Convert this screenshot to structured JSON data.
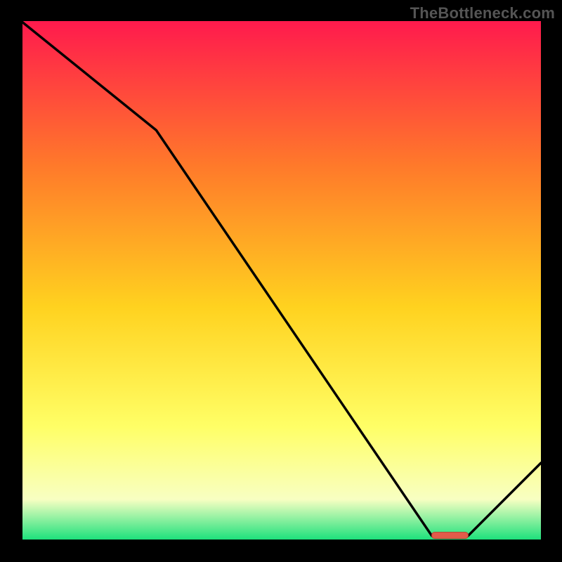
{
  "watermark": "TheBottleneck.com",
  "colors": {
    "page_bg": "#000000",
    "gradient_top": "#ff1a4d",
    "gradient_upper_mid": "#ff7a2a",
    "gradient_mid": "#ffd21f",
    "gradient_lower_mid": "#ffff66",
    "gradient_low": "#f8ffc2",
    "gradient_bottom": "#16e07a",
    "axis": "#000000",
    "curve": "#000000",
    "marker_fill": "#e25b4a",
    "marker_stroke": "#bf4030"
  },
  "chart_data": {
    "type": "line",
    "title": "",
    "xlabel": "",
    "ylabel": "",
    "xlim": [
      0,
      100
    ],
    "ylim": [
      0,
      100
    ],
    "x": [
      0,
      26,
      79,
      86,
      100
    ],
    "values": [
      100,
      79,
      1,
      1,
      15
    ],
    "optimal_marker": {
      "x_start": 79,
      "x_end": 86,
      "y": 1
    },
    "notes": "Axes have no tick labels; values are relative (0–100)."
  }
}
